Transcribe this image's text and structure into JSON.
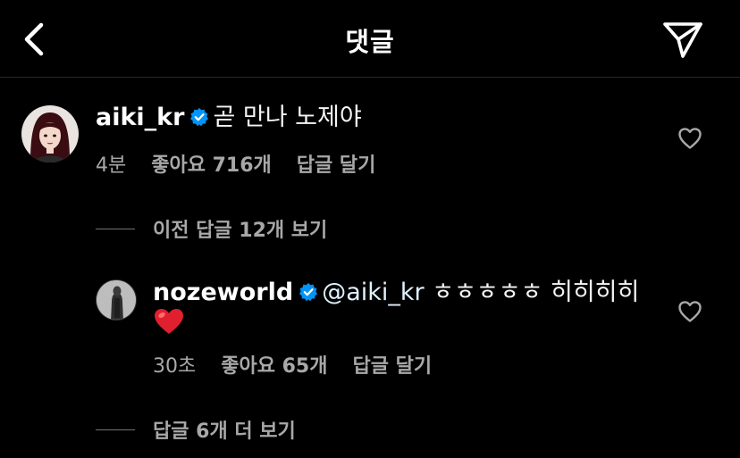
{
  "header": {
    "title": "댓글",
    "back_icon": "chevron-left-icon",
    "send_icon": "paper-plane-icon"
  },
  "comments": [
    {
      "username": "aiki_kr",
      "verified": true,
      "text": "곧 만나 노제야",
      "time": "4분",
      "likes": "좋아요 716개",
      "reply": "답글 달기"
    }
  ],
  "view_previous": "이전 답글 12개 보기",
  "reply": {
    "username": "nozeworld",
    "verified": true,
    "mention": "@aiki_kr",
    "text": " ㅎㅎㅎㅎㅎ 히히히히",
    "emoji": "❤️",
    "time": "30초",
    "likes": "좋아요 65개",
    "reply": "답글 달기"
  },
  "view_more": "답글 6개 더 보기",
  "colors": {
    "background": "#000000",
    "text": "#ffffff",
    "secondary": "#a8a8a8",
    "verified": "#0095f6"
  }
}
